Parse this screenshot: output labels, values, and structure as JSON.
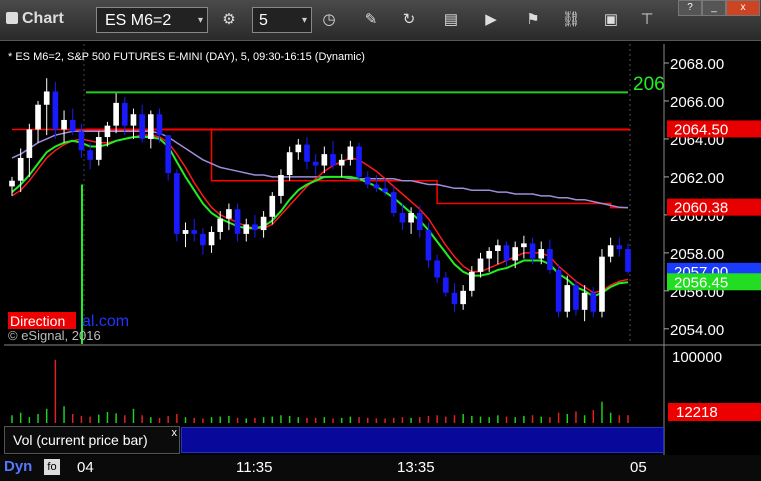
{
  "window": {
    "title": "Chart",
    "controls": [
      "?",
      "_",
      "x"
    ]
  },
  "toolbar": {
    "symbol": "ES M6=2",
    "interval": "5",
    "dropdown_glyph": "▾"
  },
  "chart_header": "* ES M6=2, S&P 500 FUTURES E-MINI (DAY), 5, 09:30-16:15 (Dynamic)",
  "watermark": {
    "brand_red": "Direction",
    "brand_blue": "al.com",
    "copyright": "© eSignal, 2016"
  },
  "price_axis": {
    "ticks": [
      "2068.00",
      "2066.00",
      "2064.00",
      "2062.00",
      "2060.00",
      "2058.00",
      "2056.00",
      "2054.00"
    ]
  },
  "price_tags": [
    {
      "text": "2064.50",
      "value": 2064.5,
      "color": "#e80000"
    },
    {
      "text": "2060.38",
      "value": 2060.38,
      "color": "#e80000"
    },
    {
      "text": "2057.00",
      "value": 2057.0,
      "color": "#1a3cff"
    },
    {
      "text": "2056.45",
      "value": 2056.45,
      "color": "#22dd22"
    }
  ],
  "green_line_label": "206",
  "volume_axis": {
    "ticks": [
      "100000"
    ],
    "current_tag": "12218"
  },
  "volume_pane_label": "Vol (current price bar)",
  "volume_close_glyph": "x",
  "bottom_bar": {
    "label": "Dyn",
    "icon_text": "fo"
  },
  "time_axis": {
    "labels": [
      "04",
      "11:35",
      "13:35",
      "05"
    ]
  },
  "colors": {
    "up": "#ffffff",
    "down": "#1a1aff",
    "ma_green": "#22ee22",
    "ma_red": "#ff1a1a",
    "ma_blue": "#5566ff",
    "ma_purple": "#a08cd8",
    "line_red": "#ff0000",
    "line_green": "#22cc22"
  },
  "chart_data": {
    "type": "candlestick",
    "y_range": [
      2053.2,
      2069.0
    ],
    "horizontal_lines": [
      {
        "value": 2066.45,
        "color": "green"
      },
      {
        "value": 2064.5,
        "color": "red"
      }
    ],
    "ohlc": [
      [
        2061.5,
        2062.0,
        2061.0,
        2061.8
      ],
      [
        2061.8,
        2063.5,
        2061.2,
        2063.0
      ],
      [
        2063.0,
        2064.8,
        2062.0,
        2064.5
      ],
      [
        2064.5,
        2066.0,
        2063.8,
        2065.8
      ],
      [
        2065.8,
        2067.2,
        2064.2,
        2066.5
      ],
      [
        2066.5,
        2067.0,
        2064.0,
        2064.5
      ],
      [
        2064.5,
        2065.5,
        2063.8,
        2065.0
      ],
      [
        2065.0,
        2065.6,
        2064.2,
        2064.4
      ],
      [
        2064.4,
        2064.8,
        2063.0,
        2063.4
      ],
      [
        2063.4,
        2063.8,
        2062.4,
        2062.9
      ],
      [
        2062.9,
        2064.4,
        2062.6,
        2064.1
      ],
      [
        2064.1,
        2064.9,
        2063.6,
        2064.7
      ],
      [
        2064.7,
        2066.4,
        2064.3,
        2065.9
      ],
      [
        2065.9,
        2066.2,
        2064.2,
        2064.7
      ],
      [
        2064.7,
        2065.6,
        2064.0,
        2065.3
      ],
      [
        2065.3,
        2065.8,
        2063.8,
        2064.0
      ],
      [
        2064.0,
        2065.5,
        2063.5,
        2065.3
      ],
      [
        2065.3,
        2065.6,
        2063.8,
        2064.2
      ],
      [
        2064.2,
        2063.8,
        2061.8,
        2062.2
      ],
      [
        2062.2,
        2062.4,
        2058.6,
        2059.0
      ],
      [
        2059.0,
        2059.6,
        2058.3,
        2059.2
      ],
      [
        2059.2,
        2059.8,
        2058.6,
        2059.0
      ],
      [
        2059.0,
        2059.3,
        2057.9,
        2058.4
      ],
      [
        2058.4,
        2059.4,
        2058.0,
        2059.1
      ],
      [
        2059.1,
        2060.2,
        2058.7,
        2059.8
      ],
      [
        2059.8,
        2060.6,
        2059.2,
        2060.3
      ],
      [
        2060.3,
        2060.6,
        2058.6,
        2059.0
      ],
      [
        2059.0,
        2059.8,
        2058.6,
        2059.5
      ],
      [
        2059.5,
        2060.0,
        2058.8,
        2059.2
      ],
      [
        2059.2,
        2060.2,
        2058.8,
        2059.9
      ],
      [
        2059.9,
        2061.2,
        2059.5,
        2061.0
      ],
      [
        2061.0,
        2062.4,
        2060.6,
        2062.1
      ],
      [
        2062.1,
        2063.6,
        2061.8,
        2063.3
      ],
      [
        2063.3,
        2064.0,
        2062.9,
        2063.7
      ],
      [
        2063.7,
        2064.1,
        2062.4,
        2062.8
      ],
      [
        2062.8,
        2063.2,
        2062.1,
        2062.6
      ],
      [
        2062.6,
        2063.6,
        2062.2,
        2063.2
      ],
      [
        2063.2,
        2063.9,
        2062.4,
        2062.6
      ],
      [
        2062.6,
        2063.2,
        2062.0,
        2062.9
      ],
      [
        2062.9,
        2063.9,
        2062.6,
        2063.6
      ],
      [
        2063.6,
        2063.8,
        2061.8,
        2062.0
      ],
      [
        2062.0,
        2062.3,
        2061.4,
        2061.6
      ],
      [
        2061.6,
        2062.1,
        2061.2,
        2061.4
      ],
      [
        2061.4,
        2061.9,
        2061.0,
        2061.2
      ],
      [
        2061.2,
        2061.5,
        2059.9,
        2060.1
      ],
      [
        2060.1,
        2060.6,
        2059.2,
        2059.6
      ],
      [
        2059.6,
        2060.4,
        2059.0,
        2060.1
      ],
      [
        2060.1,
        2060.5,
        2058.8,
        2059.2
      ],
      [
        2059.2,
        2059.6,
        2057.2,
        2057.6
      ],
      [
        2057.6,
        2057.9,
        2056.4,
        2056.7
      ],
      [
        2056.7,
        2057.0,
        2055.7,
        2055.9
      ],
      [
        2055.9,
        2056.4,
        2054.9,
        2055.3
      ],
      [
        2055.3,
        2056.3,
        2055.0,
        2056.0
      ],
      [
        2056.0,
        2057.3,
        2055.7,
        2057.0
      ],
      [
        2057.0,
        2058.0,
        2056.7,
        2057.7
      ],
      [
        2057.7,
        2058.3,
        2057.0,
        2058.1
      ],
      [
        2058.1,
        2058.7,
        2057.4,
        2058.4
      ],
      [
        2058.4,
        2058.6,
        2057.3,
        2057.6
      ],
      [
        2057.6,
        2058.6,
        2057.2,
        2058.3
      ],
      [
        2058.3,
        2058.9,
        2057.7,
        2058.5
      ],
      [
        2058.5,
        2058.8,
        2057.4,
        2057.7
      ],
      [
        2057.7,
        2058.6,
        2057.4,
        2058.2
      ],
      [
        2058.2,
        2058.7,
        2056.9,
        2057.1
      ],
      [
        2057.1,
        2057.4,
        2054.6,
        2054.9
      ],
      [
        2054.9,
        2056.8,
        2054.6,
        2056.3
      ],
      [
        2056.3,
        2056.6,
        2054.7,
        2055.0
      ],
      [
        2055.0,
        2056.3,
        2054.4,
        2055.9
      ],
      [
        2055.9,
        2056.2,
        2054.6,
        2054.9
      ],
      [
        2054.9,
        2058.2,
        2054.6,
        2057.8
      ],
      [
        2057.8,
        2058.8,
        2057.5,
        2058.4
      ],
      [
        2058.4,
        2058.8,
        2057.8,
        2058.2
      ],
      [
        2058.2,
        2058.5,
        2056.9,
        2057.0
      ]
    ],
    "ma_green": [
      2061.2,
      2061.6,
      2062.1,
      2062.7,
      2063.3,
      2063.6,
      2063.8,
      2063.9,
      2063.8,
      2063.6,
      2063.6,
      2063.7,
      2063.9,
      2064.0,
      2064.1,
      2064.1,
      2064.1,
      2064.0,
      2063.6,
      2062.8,
      2062.0,
      2061.3,
      2060.6,
      2060.1,
      2059.8,
      2059.6,
      2059.4,
      2059.3,
      2059.3,
      2059.4,
      2059.7,
      2060.2,
      2060.8,
      2061.3,
      2061.6,
      2061.8,
      2062.0,
      2062.0,
      2062.0,
      2062.0,
      2061.9,
      2061.7,
      2061.5,
      2061.2,
      2060.9,
      2060.5,
      2060.1,
      2059.7,
      2059.2,
      2058.6,
      2058.0,
      2057.4,
      2057.0,
      2056.8,
      2056.8,
      2056.9,
      2057.1,
      2057.2,
      2057.4,
      2057.6,
      2057.6,
      2057.6,
      2057.4,
      2056.9,
      2056.6,
      2056.2,
      2056.0,
      2055.7,
      2055.9,
      2056.2,
      2056.4,
      2056.45
    ],
    "ma_red": [
      2061.0,
      2061.3,
      2061.8,
      2062.4,
      2063.0,
      2063.4,
      2063.7,
      2063.9,
      2064.0,
      2063.9,
      2063.8,
      2063.8,
      2063.9,
      2064.0,
      2064.1,
      2064.2,
      2064.2,
      2064.1,
      2063.8,
      2063.2,
      2062.5,
      2061.7,
      2061.0,
      2060.4,
      2060.0,
      2059.8,
      2059.6,
      2059.4,
      2059.3,
      2059.3,
      2059.5,
      2060.0,
      2060.5,
      2061.0,
      2061.5,
      2061.9,
      2062.3,
      2062.6,
      2062.8,
      2063.0,
      2062.9,
      2062.6,
      2062.3,
      2061.9,
      2061.5,
      2061.1,
      2060.7,
      2060.3,
      2059.8,
      2059.1,
      2058.4,
      2057.8,
      2057.3,
      2057.0,
      2057.0,
      2057.2,
      2057.4,
      2057.6,
      2057.8,
      2058.0,
      2058.0,
      2058.0,
      2057.8,
      2057.3,
      2056.9,
      2056.5,
      2056.2,
      2055.9,
      2056.0,
      2056.3,
      2056.5,
      2056.6
    ],
    "ma_purple": [
      2063.0,
      2063.2,
      2063.5,
      2063.8,
      2064.0,
      2064.2,
      2064.3,
      2064.4,
      2064.4,
      2064.4,
      2064.4,
      2064.4,
      2064.4,
      2064.4,
      2064.4,
      2064.4,
      2064.4,
      2064.3,
      2064.1,
      2063.8,
      2063.5,
      2063.2,
      2062.9,
      2062.7,
      2062.5,
      2062.4,
      2062.3,
      2062.2,
      2062.1,
      2062.1,
      2062.0,
      2062.0,
      2062.0,
      2062.0,
      2062.0,
      2062.0,
      2062.0,
      2062.0,
      2062.0,
      2061.9,
      2061.9,
      2061.9,
      2061.9,
      2061.9,
      2061.9,
      2061.8,
      2061.8,
      2061.7,
      2061.6,
      2061.6,
      2061.5,
      2061.4,
      2061.4,
      2061.3,
      2061.3,
      2061.3,
      2061.2,
      2061.2,
      2061.1,
      2061.1,
      2061.1,
      2061.0,
      2061.0,
      2060.9,
      2060.9,
      2060.8,
      2060.8,
      2060.7,
      2060.6,
      2060.5,
      2060.4,
      2060.38
    ],
    "channel_red": [
      2064.5,
      2064.5,
      2064.5,
      2064.5,
      2064.5,
      2064.5,
      2064.5,
      2064.5,
      2064.5,
      2064.5,
      2064.5,
      2064.5,
      2064.5,
      2064.5,
      2064.5,
      2064.5,
      2064.5,
      2064.5,
      2064.5,
      2064.5,
      2064.5,
      2064.5,
      2064.5,
      2061.8,
      2061.8,
      2061.8,
      2061.8,
      2061.8,
      2061.8,
      2061.8,
      2061.8,
      2061.8,
      2061.8,
      2061.8,
      2061.8,
      2061.8,
      2061.8,
      2061.8,
      2061.8,
      2061.8,
      2061.8,
      2061.8,
      2061.8,
      2061.8,
      2061.8,
      2061.8,
      2061.8,
      2061.8,
      2061.8,
      2060.6,
      2060.6,
      2060.6,
      2060.6,
      2060.6,
      2060.6,
      2060.6,
      2060.6,
      2060.6,
      2060.6,
      2060.6,
      2060.6,
      2060.6,
      2060.6,
      2060.6,
      2060.6,
      2060.6,
      2060.6,
      2060.6,
      2060.6,
      2060.38,
      2060.38,
      2060.38
    ],
    "channel_green": [
      null,
      null,
      null,
      null,
      null,
      null,
      null,
      null,
      null,
      null,
      null,
      null,
      null,
      null,
      null,
      null,
      null,
      null,
      null,
      null,
      null,
      null,
      null,
      null,
      null,
      null,
      null,
      null,
      null,
      null,
      null,
      null,
      null,
      null,
      null,
      null,
      null,
      null,
      null,
      null,
      null,
      null,
      null,
      null,
      null,
      null,
      null,
      null,
      null,
      null,
      null,
      null,
      null,
      null,
      null,
      null,
      null,
      null,
      null,
      null,
      null,
      null,
      null,
      null,
      null,
      null,
      null,
      null,
      null,
      null,
      null,
      null
    ],
    "volume": [
      12000,
      16000,
      9000,
      14000,
      22000,
      98000,
      26000,
      14000,
      11000,
      10000,
      13000,
      17000,
      15000,
      12000,
      22000,
      12000,
      9000,
      8000,
      11000,
      14000,
      9000,
      8000,
      7000,
      9000,
      10000,
      11000,
      8000,
      7000,
      8000,
      9000,
      10000,
      12000,
      11000,
      9000,
      8000,
      8000,
      9000,
      7000,
      8000,
      10000,
      9000,
      8000,
      7000,
      7000,
      8000,
      9000,
      8000,
      9000,
      11000,
      12000,
      10000,
      12000,
      14000,
      11000,
      10000,
      9000,
      12000,
      10000,
      9000,
      11000,
      12000,
      10000,
      9000,
      16000,
      14000,
      18000,
      12000,
      20000,
      33000,
      16000,
      12000,
      12218
    ]
  }
}
